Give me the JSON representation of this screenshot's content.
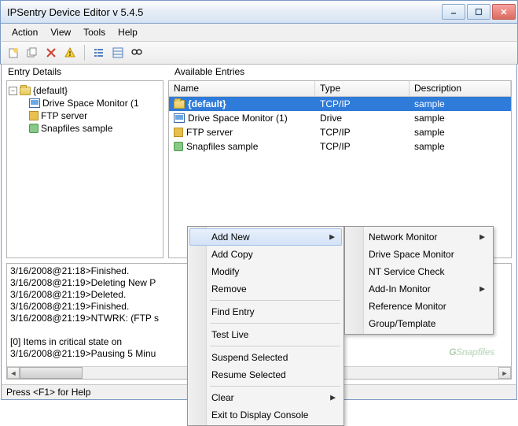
{
  "window": {
    "title": "IPSentry Device Editor v 5.4.5"
  },
  "menubar": {
    "action": "Action",
    "view": "View",
    "tools": "Tools",
    "help": "Help"
  },
  "panes": {
    "left_label": "Entry Details",
    "right_label": "Available Entries"
  },
  "tree": {
    "root": "{default}",
    "items": [
      "Drive Space Monitor (1",
      "FTP server",
      "Snapfiles sample"
    ]
  },
  "list": {
    "columns": {
      "name": "Name",
      "type": "Type",
      "desc": "Description"
    },
    "rows": [
      {
        "name": "{default}",
        "type": "TCP/IP",
        "desc": "sample",
        "selected": true,
        "bold": true,
        "icon": "folder"
      },
      {
        "name": "Drive Space Monitor (1)",
        "type": "Drive",
        "desc": "sample",
        "icon": "monitor"
      },
      {
        "name": "FTP server",
        "type": "TCP/IP",
        "desc": "sample",
        "icon": "ftp"
      },
      {
        "name": "Snapfiles sample",
        "type": "TCP/IP",
        "desc": "sample",
        "icon": "snap"
      }
    ]
  },
  "log": {
    "lines": [
      "3/16/2008@21:18>Finished.",
      "3/16/2008@21:19>Deleting New P",
      "3/16/2008@21:19>Deleted.",
      "3/16/2008@21:19>Finished.",
      "3/16/2008@21:19>NTWRK: (FTP s",
      "",
      "[0] Items in critical state on",
      "3/16/2008@21:19>Pausing 5 Minu"
    ]
  },
  "context_menu_main": {
    "add_new": "Add New",
    "add_copy": "Add Copy",
    "modify": "Modify",
    "remove": "Remove",
    "find_entry": "Find Entry",
    "test_live": "Test Live",
    "suspend": "Suspend Selected",
    "resume": "Resume Selected",
    "clear": "Clear",
    "exit": "Exit to Display Console"
  },
  "context_menu_sub": {
    "network": "Network Monitor",
    "drive": "Drive Space Monitor",
    "nt": "NT Service Check",
    "addin": "Add-In Monitor",
    "reference": "Reference Monitor",
    "group": "Group/Template"
  },
  "statusbar": {
    "text": "Press <F1> for Help"
  },
  "watermark": "Snapfiles"
}
